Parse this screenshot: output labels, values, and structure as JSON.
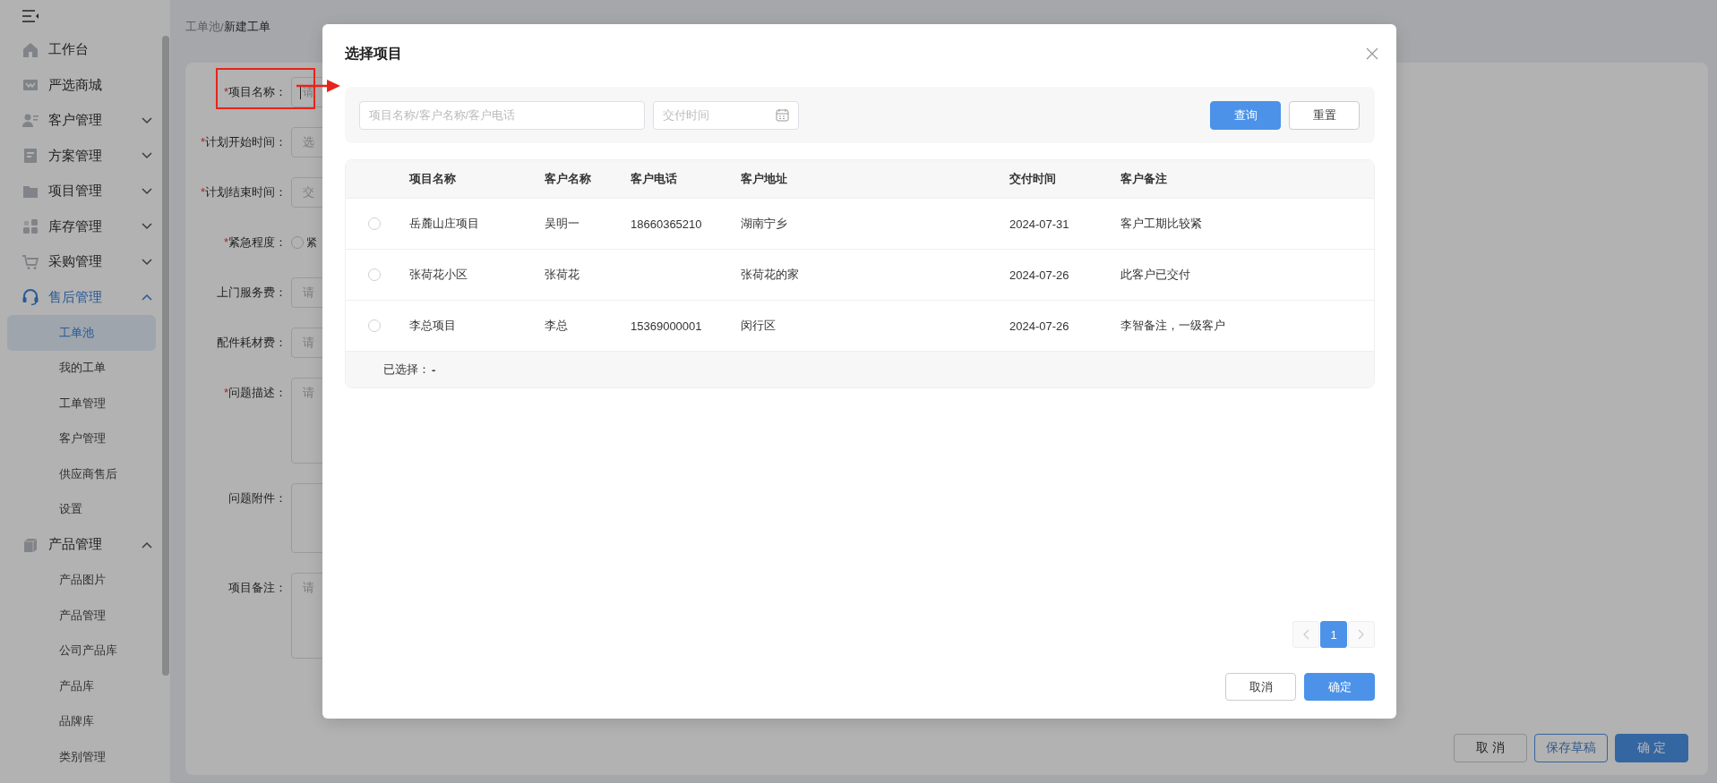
{
  "sidebar": {
    "items": [
      {
        "label": "工作台",
        "kind": "link",
        "selected": false
      },
      {
        "label": "严选商城",
        "kind": "link",
        "selected": false
      },
      {
        "label": "客户管理",
        "kind": "group",
        "expanded": false,
        "selected": false
      },
      {
        "label": "方案管理",
        "kind": "group",
        "expanded": false,
        "selected": false
      },
      {
        "label": "项目管理",
        "kind": "group",
        "expanded": false,
        "selected": false
      },
      {
        "label": "库存管理",
        "kind": "group",
        "expanded": false,
        "selected": false
      },
      {
        "label": "采购管理",
        "kind": "group",
        "expanded": false,
        "selected": false
      },
      {
        "label": "售后管理",
        "kind": "group",
        "expanded": true,
        "selected": true,
        "children": [
          {
            "label": "工单池",
            "selected": true
          },
          {
            "label": "我的工单",
            "selected": false
          },
          {
            "label": "工单管理",
            "selected": false
          },
          {
            "label": "客户管理",
            "selected": false
          },
          {
            "label": "供应商售后",
            "selected": false
          },
          {
            "label": "设置",
            "selected": false
          }
        ]
      },
      {
        "label": "产品管理",
        "kind": "group",
        "expanded": true,
        "selected": false,
        "children": [
          {
            "label": "产品图片",
            "selected": false
          },
          {
            "label": "产品管理",
            "selected": false
          },
          {
            "label": "公司产品库",
            "selected": false
          },
          {
            "label": "产品库",
            "selected": false
          },
          {
            "label": "品牌库",
            "selected": false
          },
          {
            "label": "类别管理",
            "selected": false
          }
        ]
      }
    ]
  },
  "breadcrumb": {
    "items": [
      "工单池",
      "新建工单"
    ],
    "separator": "/"
  },
  "form": {
    "fields": [
      {
        "label": "项目名称：",
        "required_mark": "*",
        "kind": "input",
        "placeholder": "请",
        "focused": true
      },
      {
        "label": "计划开始时间：",
        "required_mark": "*",
        "kind": "input",
        "placeholder": "选",
        "focused": false
      },
      {
        "label": "计划结束时间：",
        "required_mark": "*",
        "kind": "input",
        "placeholder": "交",
        "focused": false
      },
      {
        "label": "紧急程度：",
        "required_mark": "*",
        "kind": "radio",
        "options": [
          {
            "label": "紧",
            "selected": false
          }
        ]
      },
      {
        "label": "上门服务费：",
        "kind": "input",
        "placeholder": "请",
        "focused": false
      },
      {
        "label": "配件耗材费：",
        "kind": "input",
        "placeholder": "请",
        "focused": false
      },
      {
        "label": "问题描述：",
        "required_mark": "*",
        "kind": "textarea",
        "placeholder": "请"
      },
      {
        "label": "问题附件：",
        "kind": "upload"
      },
      {
        "label": "项目备注：",
        "kind": "textarea",
        "placeholder": "请"
      }
    ]
  },
  "page_actions": [
    {
      "label": "取 消",
      "kind": "default"
    },
    {
      "label": "保存草稿",
      "kind": "outline"
    },
    {
      "label": "确 定",
      "kind": "primary"
    }
  ],
  "modal": {
    "title": "选择项目",
    "search": {
      "keyword_placeholder": "项目名称/客户名称/客户电话",
      "date_placeholder": "交付时间",
      "buttons": [
        {
          "label": "查询",
          "primary": true
        },
        {
          "label": "重置",
          "primary": false
        }
      ]
    },
    "table": {
      "columns": [
        "项目名称",
        "客户名称",
        "客户电话",
        "客户地址",
        "交付时间",
        "客户备注"
      ],
      "rows": [
        {
          "selected": false,
          "project": "岳麓山庄项目",
          "customer": "吴明一",
          "phone": "18660365210",
          "address": "湖南宁乡",
          "date": "2024-07-31",
          "note": "客户工期比较紧"
        },
        {
          "selected": false,
          "project": "张荷花小区",
          "customer": "张荷花",
          "address": "张荷花的家",
          "date": "2024-07-26",
          "note": "此客户已交付"
        },
        {
          "selected": false,
          "project": "李总项目",
          "customer": "李总",
          "phone": "15369000001",
          "address": "闵行区",
          "date": "2024-07-26",
          "note": "李智备注，一级客户"
        }
      ],
      "footer": {
        "label": "已选择：",
        "value": "-"
      }
    },
    "pagination": {
      "pages": [
        {
          "label": "1",
          "selected": true
        }
      ]
    },
    "buttons": [
      {
        "label": "取消",
        "primary": false
      },
      {
        "label": "确定",
        "primary": true
      }
    ]
  }
}
